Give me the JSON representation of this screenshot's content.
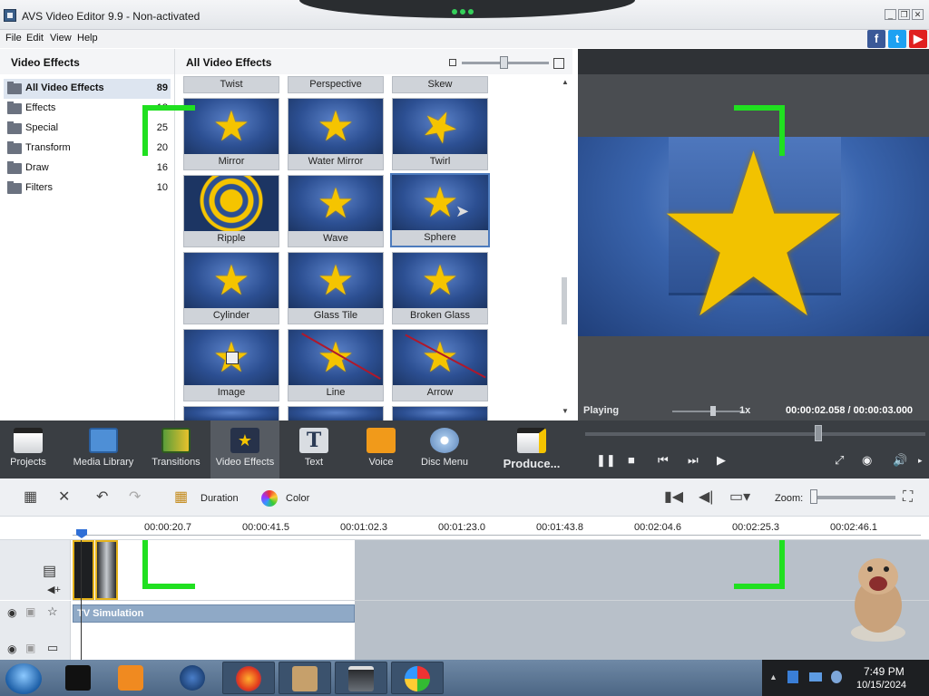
{
  "window": {
    "title": "AVS Video Editor 9.9 - Non-activated",
    "controls": [
      "_",
      "❐",
      "✕"
    ]
  },
  "menu": [
    "File",
    "Edit",
    "View",
    "Help"
  ],
  "social": [
    {
      "name": "facebook-icon",
      "glyph": "f",
      "color": "#3b5998"
    },
    {
      "name": "twitter-icon",
      "glyph": "t",
      "color": "#1da1f2"
    },
    {
      "name": "youtube-icon",
      "glyph": "▶",
      "color": "#e02020"
    }
  ],
  "left_panel": {
    "title": "Video Effects",
    "categories": [
      {
        "label": "All Video Effects",
        "count": "89"
      },
      {
        "label": "Effects",
        "count": "18"
      },
      {
        "label": "Special",
        "count": "25"
      },
      {
        "label": "Transform",
        "count": "20"
      },
      {
        "label": "Draw",
        "count": "16"
      },
      {
        "label": "Filters",
        "count": "10"
      }
    ]
  },
  "grid_panel": {
    "title": "All Video Effects",
    "top_labels": [
      "Twist",
      "Perspective",
      "Skew"
    ],
    "effects": [
      "Mirror",
      "Water Mirror",
      "Twirl",
      "Ripple",
      "Wave",
      "Sphere",
      "Cylinder",
      "Glass Tile",
      "Broken Glass",
      "Image",
      "Line",
      "Arrow"
    ],
    "selected": "Sphere"
  },
  "preview": {
    "status": "Playing",
    "speed": "1x",
    "time": "00:00:02.058 / 00:00:03.000"
  },
  "toolbar": {
    "items": [
      {
        "label": "Projects",
        "icon": "clapperboard-icon"
      },
      {
        "label": "Media Library",
        "icon": "film-icon"
      },
      {
        "label": "Transitions",
        "icon": "transitions-icon"
      },
      {
        "label": "Video Effects",
        "icon": "star-icon"
      },
      {
        "label": "Text",
        "icon": "text-icon"
      },
      {
        "label": "Voice",
        "icon": "microphone-icon"
      },
      {
        "label": "Disc Menu",
        "icon": "disc-icon"
      },
      {
        "label": "Produce...",
        "icon": "produce-icon"
      }
    ],
    "active": "Video Effects"
  },
  "timeline_toolbar": {
    "duration_label": "Duration",
    "color_label": "Color",
    "zoom_label": "Zoom:"
  },
  "ruler": {
    "ticks": [
      "00:00:20.7",
      "00:00:41.5",
      "00:01:02.3",
      "00:01:23.0",
      "00:01:43.8",
      "00:02:04.6",
      "00:02:25.3",
      "00:02:46.1"
    ]
  },
  "timeline": {
    "effect_bar_label": "TV Simulation"
  },
  "taskbar": {
    "time": "7:49 PM",
    "date": "10/15/2024",
    "apps": [
      "terminal-app-icon",
      "media-player-icon",
      "settings-orb-icon",
      "firefox-icon",
      "hamster-box-icon",
      "video-editor-icon",
      "windows-logo-icon"
    ]
  }
}
